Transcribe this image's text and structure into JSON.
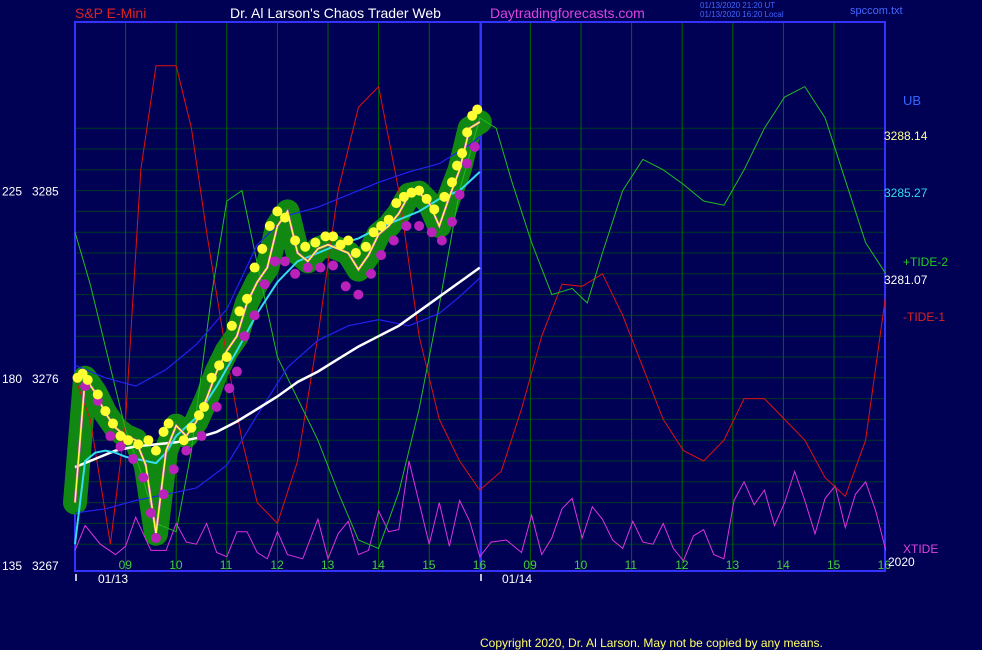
{
  "header": {
    "symbol": "S&P E-Mini",
    "author": "Dr. Al Larson's Chaos Trader Web",
    "site": "Daytradingforecasts.com",
    "stamp_line1": "01/13/2020 21:20 UT",
    "stamp_line2": "01/13/2020 16:20 Local",
    "file": "spccom.txt"
  },
  "footer": {
    "copyright": "Copyright 2020, Dr. Al Larson. May not be copied by any means."
  },
  "colors": {
    "background": "#000055",
    "frame": "#3333ff",
    "grid": "#006600",
    "tide1": "#dd1111",
    "tide2": "#22bb22",
    "xtide": "#dd33dd",
    "price": "#ffff44",
    "ma_fast": "#33ddee",
    "ma_slow": "#ffffff",
    "band": "#2222ee",
    "dot_high": "#ffff33",
    "dot_low": "#bb22bb",
    "glow": "#118811"
  },
  "chart_data": {
    "type": "line",
    "title": "S&P E-Mini",
    "xlabel": "",
    "ylabel": "",
    "ylim": [
      3267,
      3289
    ],
    "y_ticks": [
      {
        "osc": "135",
        "price": "3267"
      },
      {
        "osc": "180",
        "price": "3276"
      },
      {
        "osc": "225",
        "price": "3285"
      }
    ],
    "x_ticks": [
      "09",
      "10",
      "11",
      "12",
      "13",
      "14",
      "15",
      "16",
      "09",
      "10",
      "11",
      "12",
      "13",
      "14",
      "15",
      "16"
    ],
    "date_labels": [
      "01/13",
      "01/14"
    ],
    "year": "2020",
    "right_labels": {
      "ub": "UB",
      "price_top": "3288.14",
      "price_ma": "3285.27",
      "tide2": "+TIDE-2",
      "price_low": "3281.07",
      "tide1": "-TIDE-1",
      "xtide": "XTIDE"
    },
    "price": {
      "hours": [
        8.0,
        8.2,
        8.4,
        8.6,
        8.8,
        9.0,
        9.2,
        9.4,
        9.6,
        9.8,
        10.0,
        10.2,
        10.4,
        10.6,
        10.8,
        11.0,
        11.2,
        11.4,
        11.6,
        11.8,
        12.0,
        12.2,
        12.4,
        12.6,
        12.8,
        13.0,
        13.2,
        13.4,
        13.6,
        13.8,
        14.0,
        14.2,
        14.4,
        14.6,
        14.8,
        15.0,
        15.2,
        15.4,
        15.6,
        15.8,
        16.0
      ],
      "values": [
        3270.0,
        3276.0,
        3275.3,
        3274.3,
        3273.6,
        3273.2,
        3273.0,
        3271.8,
        3268.5,
        3272.5,
        3273.7,
        3273.2,
        3273.9,
        3275.0,
        3276.3,
        3277.3,
        3278.0,
        3279.6,
        3280.6,
        3281.3,
        3283.3,
        3284.0,
        3282.0,
        3281.6,
        3282.2,
        3282.4,
        3282.2,
        3282.0,
        3281.2,
        3281.9,
        3282.9,
        3283.3,
        3283.9,
        3284.8,
        3284.9,
        3284.4,
        3283.3,
        3284.7,
        3286.0,
        3288.0,
        3288.3
      ]
    },
    "ma_fast": {
      "hours": [
        8.0,
        8.2,
        8.4,
        8.6,
        8.8,
        9.0,
        9.2,
        9.4,
        9.6,
        9.8,
        10.0,
        10.4,
        10.8,
        11.2,
        11.6,
        12.0,
        12.4,
        12.8,
        13.2,
        13.6,
        14.0,
        14.4,
        14.8,
        15.2,
        15.6,
        16.0
      ],
      "values": [
        3268.0,
        3272.0,
        3272.4,
        3272.5,
        3272.4,
        3272.2,
        3272.1,
        3272.0,
        3271.9,
        3272.4,
        3273.2,
        3274.1,
        3275.6,
        3277.3,
        3279.1,
        3280.6,
        3281.6,
        3282.0,
        3282.4,
        3282.7,
        3283.2,
        3283.6,
        3284.0,
        3284.6,
        3285.0,
        3285.9
      ]
    },
    "ma_slow": {
      "hours": [
        8.0,
        8.4,
        8.8,
        9.2,
        9.6,
        10.0,
        10.4,
        10.8,
        11.2,
        11.6,
        12.0,
        12.4,
        12.8,
        13.2,
        13.6,
        14.0,
        14.4,
        14.8,
        15.2,
        15.6,
        16.0
      ],
      "values": [
        3271.7,
        3272.1,
        3272.5,
        3272.7,
        3272.8,
        3272.9,
        3273.1,
        3273.4,
        3273.9,
        3274.5,
        3275.1,
        3275.8,
        3276.3,
        3276.9,
        3277.5,
        3278.0,
        3278.5,
        3279.2,
        3279.9,
        3280.6,
        3281.3
      ]
    },
    "band_upper": {
      "hours": [
        8.0,
        8.6,
        9.2,
        9.8,
        10.4,
        11.0,
        11.6,
        12.2,
        12.8,
        13.4,
        14.0,
        14.6,
        15.2,
        15.8,
        16.0
      ],
      "values": [
        3276.6,
        3276.0,
        3275.6,
        3276.4,
        3277.6,
        3279.3,
        3282.4,
        3283.8,
        3284.2,
        3284.8,
        3285.4,
        3285.9,
        3286.3,
        3287.2,
        3287.6
      ]
    },
    "band_lower": {
      "hours": [
        8.0,
        8.6,
        9.2,
        9.8,
        10.4,
        11.0,
        11.6,
        12.2,
        12.8,
        13.4,
        14.0,
        14.6,
        15.2,
        15.6,
        16.0
      ],
      "values": [
        3269.5,
        3269.7,
        3270.1,
        3270.4,
        3270.7,
        3271.8,
        3274.2,
        3276.5,
        3277.8,
        3278.5,
        3278.8,
        3278.5,
        3279.1,
        3279.9,
        3280.8
      ]
    },
    "tide1": {
      "hours": [
        8.0,
        8.3,
        8.7,
        9.0,
        9.3,
        9.6,
        10.0,
        10.3,
        10.6,
        11.0,
        11.3,
        11.6,
        12.0,
        12.4,
        12.8,
        13.2,
        13.6,
        14.0,
        14.4,
        14.8,
        15.2,
        15.6,
        16.0,
        16.4,
        16.8,
        17.2,
        17.6,
        18.0,
        18.4,
        18.8,
        19.2,
        19.6,
        20.0,
        20.4,
        20.8,
        21.2,
        21.6,
        22.0,
        22.4,
        22.8,
        23.2,
        23.6,
        24.0
      ],
      "values": [
        3276.0,
        3274.0,
        3268.0,
        3274.0,
        3286.0,
        3291.0,
        3291.0,
        3288.0,
        3283.0,
        3277.0,
        3273.0,
        3270.0,
        3269.0,
        3272.0,
        3278.0,
        3285.0,
        3289.0,
        3290.0,
        3285.0,
        3278.0,
        3274.0,
        3272.0,
        3270.6,
        3271.5,
        3274.5,
        3278.0,
        3280.5,
        3280.4,
        3281.0,
        3279.0,
        3276.5,
        3274.0,
        3272.5,
        3272.0,
        3273.0,
        3275.0,
        3275.0,
        3274.0,
        3273.0,
        3271.2,
        3270.3,
        3273.0,
        3280.0
      ]
    },
    "tide2": {
      "hours": [
        8.0,
        8.3,
        8.7,
        9.0,
        9.3,
        9.6,
        10.0,
        10.3,
        10.7,
        11.0,
        11.3,
        11.6,
        12.0,
        12.4,
        12.8,
        13.2,
        13.6,
        14.0,
        14.4,
        14.8,
        15.2,
        15.6,
        16.0,
        16.3,
        16.6,
        17.0,
        17.4,
        17.8,
        18.1,
        18.4,
        18.8,
        19.2,
        19.6,
        20.0,
        20.4,
        20.8,
        21.2,
        21.6,
        22.0,
        22.4,
        22.8,
        23.2,
        23.6,
        24.0
      ],
      "values": [
        3283.0,
        3280.5,
        3276.5,
        3273.5,
        3271.5,
        3269.0,
        3268.6,
        3272.5,
        3280.0,
        3284.5,
        3285.0,
        3281.5,
        3277.0,
        3275.0,
        3273.0,
        3270.5,
        3268.2,
        3267.8,
        3270.5,
        3274.5,
        3279.5,
        3285.0,
        3288.5,
        3288.0,
        3285.5,
        3282.5,
        3280.0,
        3280.3,
        3279.6,
        3282.0,
        3285.0,
        3286.5,
        3286.0,
        3285.3,
        3284.5,
        3284.3,
        3286.0,
        3288.0,
        3289.5,
        3290.0,
        3288.5,
        3285.5,
        3282.5,
        3281.0
      ]
    },
    "xtide": {
      "hours": [
        8.0,
        8.2,
        8.5,
        8.8,
        9.0,
        9.2,
        9.5,
        9.8,
        10.0,
        10.2,
        10.4,
        10.6,
        10.8,
        11.0,
        11.2,
        11.4,
        11.6,
        11.8,
        12.0,
        12.2,
        12.5,
        12.8,
        13.0,
        13.2,
        13.4,
        13.6,
        13.8,
        14.0,
        14.2,
        14.4,
        14.6,
        14.8,
        15.0,
        15.2,
        15.4,
        15.6,
        15.8,
        16.0,
        16.2,
        16.5,
        16.8,
        17.0,
        17.2,
        17.4,
        17.6,
        17.8,
        18.0,
        18.2,
        18.4,
        18.6,
        18.8,
        19.0,
        19.2,
        19.4,
        19.6,
        19.8,
        20.0,
        20.2,
        20.4,
        20.6,
        20.8,
        21.0,
        21.2,
        21.4,
        21.6,
        21.8,
        22.0,
        22.2,
        22.4,
        22.6,
        22.8,
        23.0,
        23.2,
        23.4,
        23.6,
        23.8,
        24.0
      ],
      "values": [
        3267.7,
        3268.9,
        3268.0,
        3267.5,
        3267.9,
        3269.3,
        3267.7,
        3267.7,
        3269.0,
        3268.1,
        3268.0,
        3269.0,
        3267.6,
        3267.4,
        3268.6,
        3268.6,
        3267.6,
        3267.3,
        3268.6,
        3267.5,
        3267.3,
        3269.2,
        3267.3,
        3268.5,
        3269.1,
        3267.5,
        3267.7,
        3269.6,
        3268.6,
        3268.7,
        3272.0,
        3270.0,
        3268.0,
        3270.0,
        3267.9,
        3270.1,
        3269.1,
        3267.4,
        3268.1,
        3268.2,
        3267.6,
        3269.4,
        3267.5,
        3268.3,
        3269.7,
        3270.2,
        3268.3,
        3269.8,
        3269.2,
        3268.2,
        3267.8,
        3269.1,
        3268.1,
        3268.0,
        3269.0,
        3267.8,
        3267.2,
        3268.4,
        3268.7,
        3267.5,
        3267.3,
        3270.1,
        3271.0,
        3269.9,
        3270.6,
        3268.9,
        3270.0,
        3271.5,
        3270.1,
        3268.5,
        3270.2,
        3270.8,
        3268.8,
        3270.4,
        3271.0,
        3269.6,
        3267.7
      ]
    },
    "yellow_dots": [
      [
        8.05,
        3276.0
      ],
      [
        8.15,
        3276.2
      ],
      [
        8.25,
        3275.9
      ],
      [
        8.45,
        3275.2
      ],
      [
        8.6,
        3274.4
      ],
      [
        8.75,
        3273.8
      ],
      [
        8.9,
        3273.2
      ],
      [
        9.05,
        3273.0
      ],
      [
        9.25,
        3272.8
      ],
      [
        9.45,
        3273.0
      ],
      [
        9.6,
        3272.5
      ],
      [
        9.75,
        3273.4
      ],
      [
        9.85,
        3273.8
      ],
      [
        10.15,
        3273.0
      ],
      [
        10.3,
        3273.6
      ],
      [
        10.45,
        3274.2
      ],
      [
        10.55,
        3274.6
      ],
      [
        10.7,
        3276.0
      ],
      [
        10.85,
        3276.6
      ],
      [
        11.0,
        3277.0
      ],
      [
        11.1,
        3278.5
      ],
      [
        11.25,
        3279.2
      ],
      [
        11.4,
        3279.8
      ],
      [
        11.55,
        3281.3
      ],
      [
        11.7,
        3282.2
      ],
      [
        11.85,
        3283.3
      ],
      [
        12.0,
        3284.0
      ],
      [
        12.15,
        3283.7
      ],
      [
        12.35,
        3282.6
      ],
      [
        12.55,
        3282.3
      ],
      [
        12.75,
        3282.5
      ],
      [
        12.95,
        3282.8
      ],
      [
        13.1,
        3282.8
      ],
      [
        13.25,
        3282.4
      ],
      [
        13.4,
        3282.6
      ],
      [
        13.55,
        3282.0
      ],
      [
        13.75,
        3282.3
      ],
      [
        13.9,
        3283.0
      ],
      [
        14.05,
        3283.3
      ],
      [
        14.2,
        3283.6
      ],
      [
        14.35,
        3284.4
      ],
      [
        14.5,
        3284.7
      ],
      [
        14.65,
        3284.9
      ],
      [
        14.8,
        3285.0
      ],
      [
        14.95,
        3284.6
      ],
      [
        15.1,
        3284.1
      ],
      [
        15.3,
        3284.7
      ],
      [
        15.45,
        3285.4
      ],
      [
        15.55,
        3286.2
      ],
      [
        15.65,
        3286.8
      ],
      [
        15.75,
        3287.8
      ],
      [
        15.85,
        3288.6
      ],
      [
        15.95,
        3288.9
      ]
    ],
    "magenta_dots": [
      [
        8.2,
        3275.6
      ],
      [
        8.45,
        3274.9
      ],
      [
        8.7,
        3273.2
      ],
      [
        8.9,
        3272.7
      ],
      [
        9.15,
        3272.1
      ],
      [
        9.35,
        3271.2
      ],
      [
        9.5,
        3269.5
      ],
      [
        9.6,
        3268.3
      ],
      [
        9.75,
        3270.4
      ],
      [
        9.95,
        3271.6
      ],
      [
        10.2,
        3272.5
      ],
      [
        10.5,
        3273.2
      ],
      [
        10.8,
        3274.6
      ],
      [
        11.05,
        3275.5
      ],
      [
        11.2,
        3276.3
      ],
      [
        11.35,
        3278.0
      ],
      [
        11.55,
        3279.0
      ],
      [
        11.75,
        3280.5
      ],
      [
        11.95,
        3281.6
      ],
      [
        12.15,
        3281.6
      ],
      [
        12.35,
        3281.0
      ],
      [
        12.6,
        3281.3
      ],
      [
        12.85,
        3281.3
      ],
      [
        13.1,
        3281.4
      ],
      [
        13.35,
        3280.4
      ],
      [
        13.6,
        3280.0
      ],
      [
        13.85,
        3281.0
      ],
      [
        14.05,
        3281.9
      ],
      [
        14.3,
        3282.6
      ],
      [
        14.55,
        3283.3
      ],
      [
        14.8,
        3283.3
      ],
      [
        15.05,
        3283.0
      ],
      [
        15.25,
        3282.6
      ],
      [
        15.45,
        3283.5
      ],
      [
        15.6,
        3284.8
      ],
      [
        15.75,
        3286.3
      ],
      [
        15.9,
        3287.1
      ]
    ]
  }
}
